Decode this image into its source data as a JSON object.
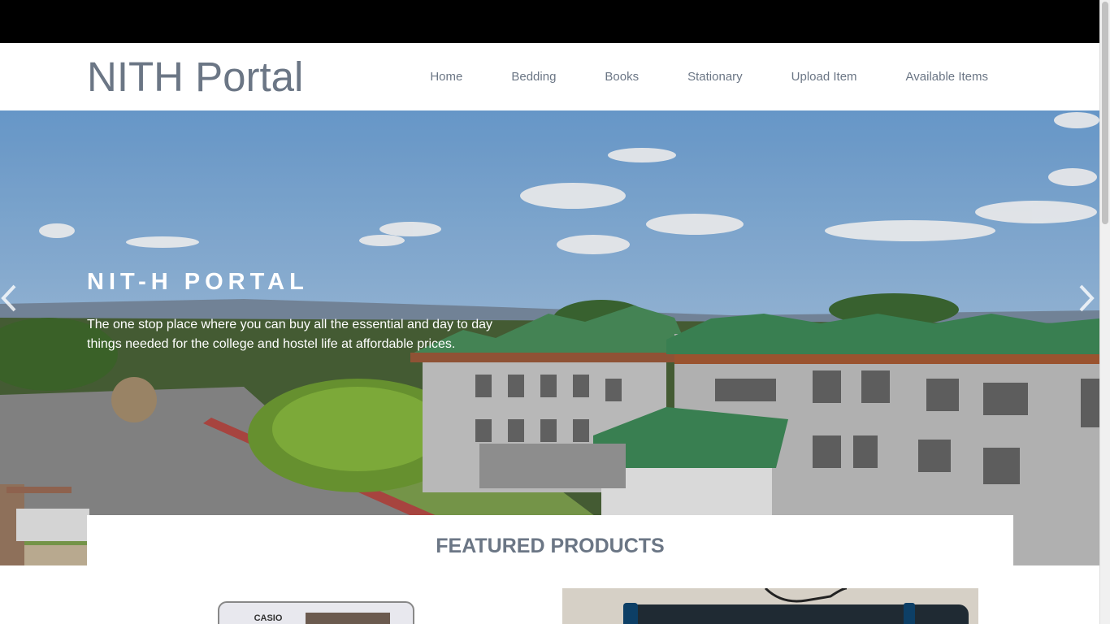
{
  "header": {
    "brand": "NITH Portal",
    "nav": [
      "Home",
      "Bedding",
      "Books",
      "Stationary",
      "Upload Item",
      "Available Items"
    ]
  },
  "hero": {
    "title": "NIT-H PORTAL",
    "text": "The one stop place where you can buy all the essential and day to day things needed for the college and hostel life at affordable prices.",
    "prev_icon": "chevron-left-icon",
    "next_icon": "chevron-right-icon"
  },
  "featured": {
    "title": "FEATURED PRODUCTS",
    "products": [
      {
        "brand_text": "CASIO"
      },
      {
        "brand_text": ""
      }
    ]
  },
  "colors": {
    "top_bar": "#000000",
    "text_muted": "#6b7685",
    "roof_green": "#3e8a58",
    "sky": "#a9c8e6"
  }
}
